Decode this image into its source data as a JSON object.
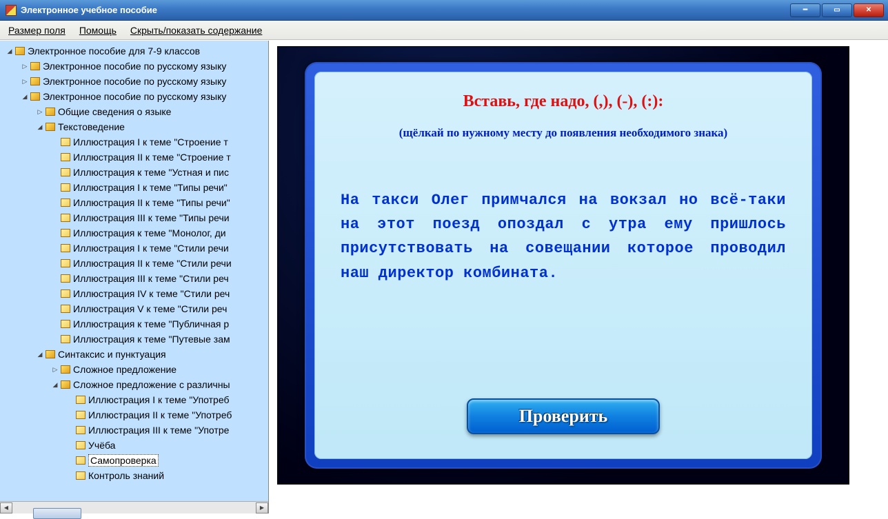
{
  "window": {
    "title": "Электронное учебное пособие"
  },
  "menu": {
    "field_size": "Размер поля",
    "help": "Помощь",
    "toggle_toc": "Скрыть/показать содержание"
  },
  "tree": {
    "root": "Электронное пособие для 7-9 классов",
    "n1": "Электронное пособие по русскому языку",
    "n2": "Электронное пособие по русскому языку",
    "n3": "Электронное пособие по русскому языку",
    "n3_1": "Общие сведения о языке",
    "n3_2": "Текстоведение",
    "n3_2_items": [
      "Иллюстрация I к теме \"Строение т",
      "Иллюстрация II к теме \"Строение т",
      "Иллюстрация к теме \"Устная и пис",
      "Иллюстрация I к теме \"Типы речи\"",
      "Иллюстрация II к теме \"Типы речи\"",
      "Иллюстрация III к теме \"Типы речи",
      "Иллюстрация к теме \"Монолог, ди",
      "Иллюстрация I к теме \"Стили речи",
      "Иллюстрация II к теме \"Стили речи",
      "Иллюстрация III к теме \"Стили реч",
      "Иллюстрация IV к теме \"Стили реч",
      "Иллюстрация V к теме \"Стили реч",
      "Иллюстрация к теме \"Публичная р",
      "Иллюстрация к теме \"Путевые зам"
    ],
    "n3_3": "Синтаксис и пунктуация",
    "n3_3_1": "Сложное предложение",
    "n3_3_2": "Сложное предложение с различны",
    "n3_3_2_items": [
      "Иллюстрация I к теме \"Употреб",
      "Иллюстрация II к теме \"Употреб",
      "Иллюстрация III к теме \"Употре",
      "Учёба",
      "Самопроверка",
      "Контроль знаний"
    ],
    "selected": "Самопроверка"
  },
  "task": {
    "title": "Вставь, где надо, (,), (-), (:):",
    "hint": "(щёлкай по нужному месту до появления необходимого знака)",
    "body": "На такси Олег примчался на вокзал но всё-таки на этот поезд опоздал с утра ему пришлось присутствовать на совещании которое проводил наш директор комбината.",
    "check_label": "Проверить"
  }
}
